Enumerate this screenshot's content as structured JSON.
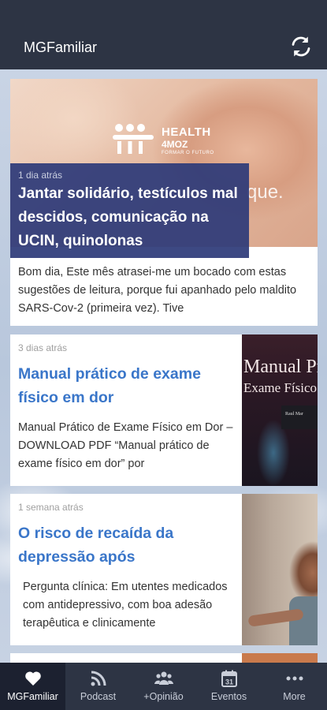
{
  "app_title": "MGFamiliar",
  "icons": {
    "refresh": "refresh-icon"
  },
  "articles": [
    {
      "time": "1 dia atrás",
      "headline": "Jantar solidário, testículos mal descidos, comunicação na UCIN, quinolonas",
      "excerpt": "Bom dia, Este mês atrasei-me um bocado com estas sugestões de leitura, porque fui apanhado pelo maldito SARS-Cov-2 (primeira vez). Tive",
      "image_logo": {
        "line1": "HEALTH",
        "line2": "4MOZ",
        "line3": "FORMAR O FUTURO"
      },
      "image_text": "que."
    },
    {
      "time": "3 dias atrás",
      "headline": "Manual prático de exame físico em dor",
      "excerpt": "Manual Prático de Exame Físico em Dor – DOWNLOAD PDF “Manual prático de exame físico em dor” por",
      "image_text": {
        "line1": "Manual Prá",
        "line2": "Exame Físico",
        "line3": "Raul Mar"
      }
    },
    {
      "time": "1 semana atrás",
      "headline": "O risco de recaída da depressão após",
      "excerpt": "Pergunta clínica: Em utentes medicados com antidepressivo, com boa adesão terapêutica e clinicamente"
    }
  ],
  "bottom_nav": [
    {
      "label": "MGFamiliar",
      "icon": "heart-icon",
      "active": true
    },
    {
      "label": "Podcast",
      "icon": "rss-icon",
      "active": false
    },
    {
      "label": "+Opinião",
      "icon": "group-icon",
      "active": false
    },
    {
      "label": "Eventos",
      "icon": "calendar-icon",
      "active": false,
      "badge": "31"
    },
    {
      "label": "More",
      "icon": "more-icon",
      "active": false
    }
  ],
  "colors": {
    "bar": "#2d3444",
    "bar_active": "#1c2130",
    "headline_link": "#3a76c9",
    "hero_overlay": "#2c3a78"
  }
}
